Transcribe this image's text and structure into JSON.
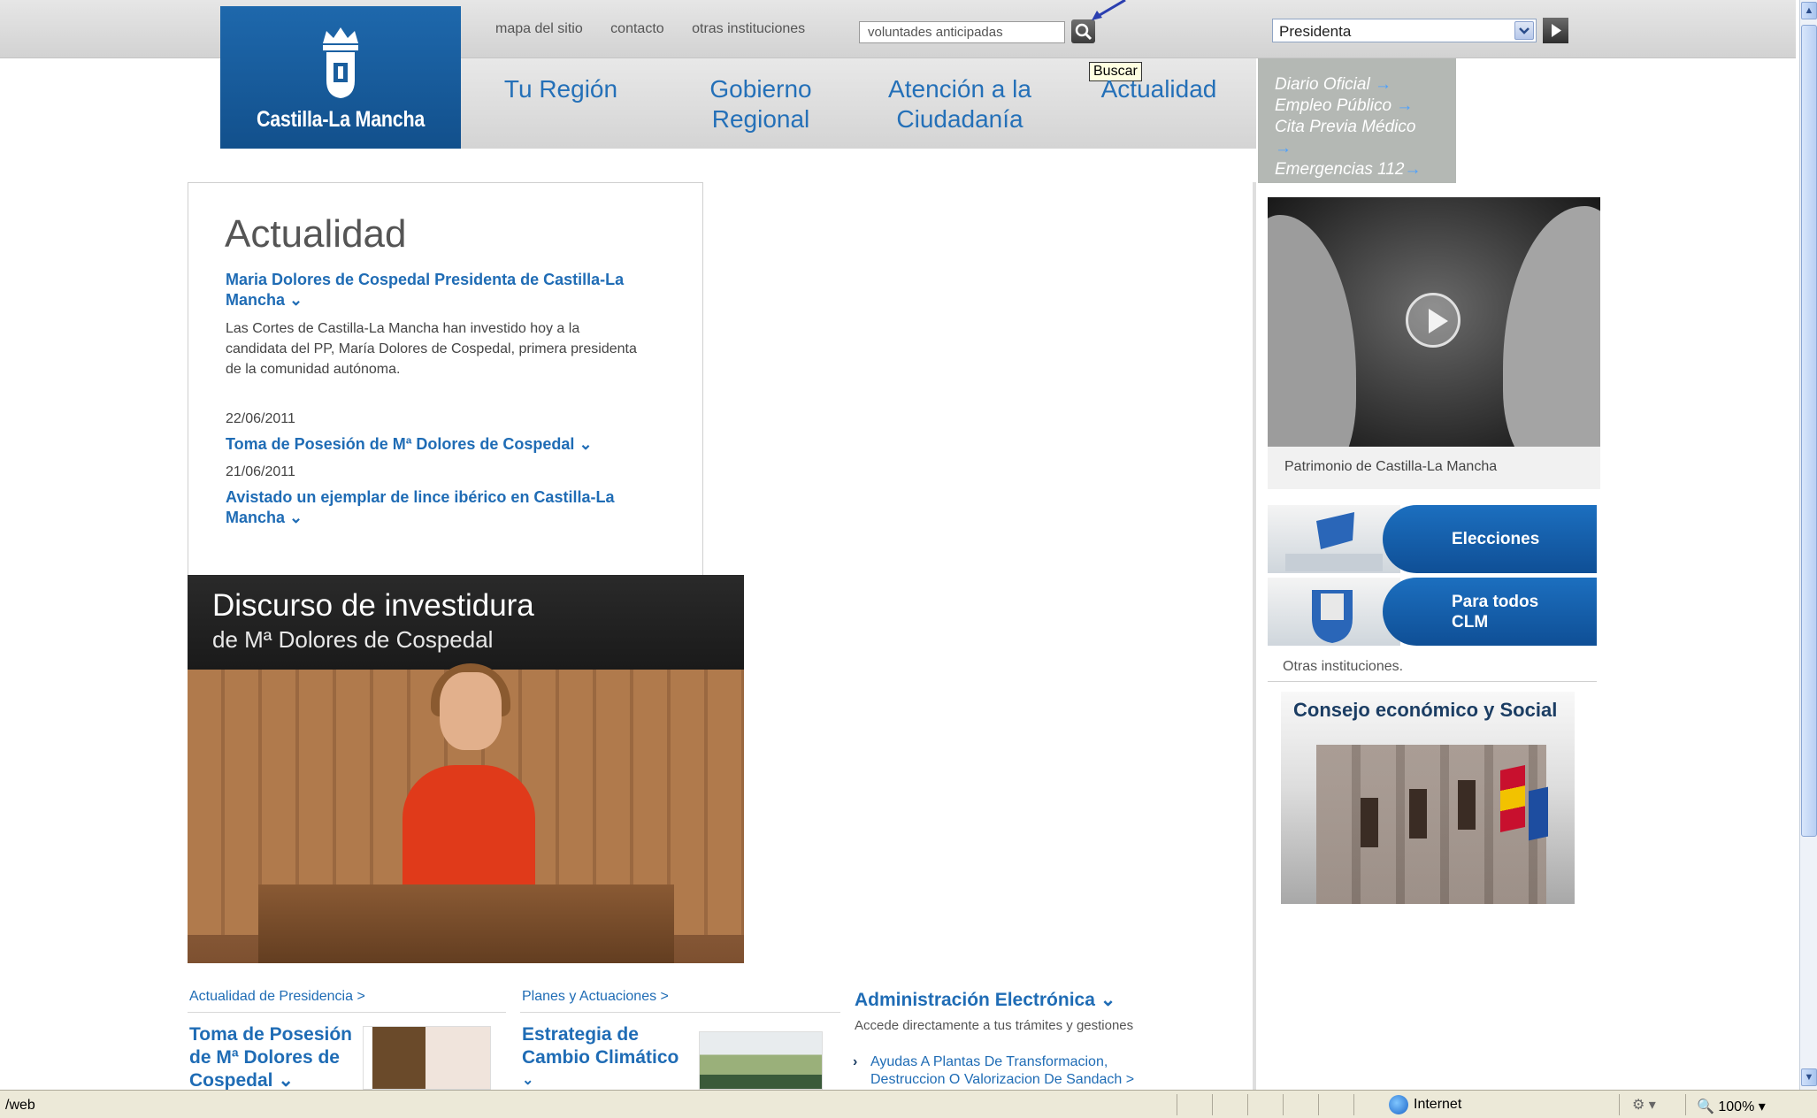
{
  "header": {
    "logo_text": "Castilla-La Mancha",
    "top_links": [
      "mapa del sitio",
      "contacto",
      "otras instituciones"
    ],
    "search": {
      "value": "voluntades anticipadas",
      "tooltip": "Buscar"
    },
    "select": {
      "value": "Presidenta"
    }
  },
  "nav": {
    "items": [
      {
        "line1": "Tu Región",
        "line2": ""
      },
      {
        "line1": "Gobierno",
        "line2": "Regional"
      },
      {
        "line1": "Atención a la",
        "line2": "Ciudadanía"
      },
      {
        "line1": "Actualidad",
        "line2": ""
      }
    ],
    "quick_links": [
      "Diario Oficial",
      "Empleo Público",
      "Cita Previa Médico",
      "Emergencias 112"
    ]
  },
  "actualidad": {
    "title": "Actualidad",
    "lead": {
      "headline_1": "Maria Dolores de Cospedal Presidenta de Castilla-La",
      "headline_2": "Mancha",
      "body": [
        "Las Cortes de Castilla-La Mancha han investido hoy a la",
        "candidata del PP, María Dolores de Cospedal, primera presidenta",
        "de la comunidad autónoma."
      ]
    },
    "news": [
      {
        "date": "22/06/2011",
        "line1": "Toma de Posesión de Mª Dolores de Cospedal",
        "line2": ""
      },
      {
        "date": "21/06/2011",
        "line1": "Avistado un ejemplar de lince ibérico en Castilla-La",
        "line2": "Mancha"
      }
    ]
  },
  "banner": {
    "title": "Discurso de investidura",
    "subtitle": "de Mª Dolores de Cospedal"
  },
  "bottom": {
    "col1": {
      "header": "Actualidad de Presidencia >",
      "lines": [
        "Toma de Posesión",
        "de Mª Dolores de",
        "Cospedal"
      ]
    },
    "col2": {
      "header": "Planes y Actuaciones >",
      "lines": [
        "Estrategia de",
        "Cambio Climático"
      ]
    },
    "admin": {
      "title": "Administración Electrónica",
      "subtitle": "Accede directamente a tus trámites y gestiones",
      "item_1": "Ayudas A Plantas De Transformacion,",
      "item_2": "Destruccion O Valorizacion De Sandach >"
    }
  },
  "sidebar": {
    "video_caption": "Patrimonio de Castilla-La Mancha",
    "promos": [
      {
        "line1": "Elecciones",
        "line2": ""
      },
      {
        "line1": "Para todos",
        "line2": "CLM"
      }
    ],
    "otras": "Otras instituciones.",
    "consejo": "Consejo económico y Social"
  },
  "statusbar": {
    "url": "/web",
    "zone": "Internet",
    "zoom": "100%"
  },
  "colors": {
    "link_blue": "#1f6cb5",
    "logo_blue": "#1a5e9e",
    "quick_bg": "#b4b8b4",
    "promo_blue": "#1566b3"
  }
}
